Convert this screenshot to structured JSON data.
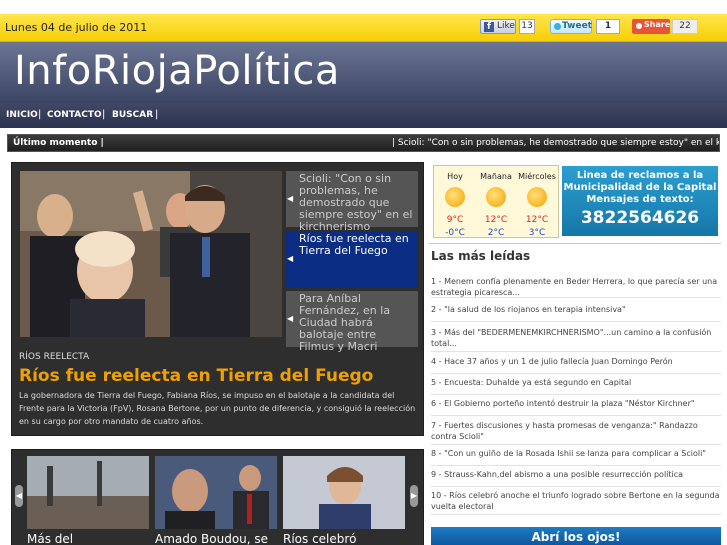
{
  "topbar": {
    "date": "Lunes 04 de julio de 2011",
    "like_label": "Like",
    "like_count": "13",
    "tweet_label": "Tweet",
    "tweet_count": "1",
    "share_label": "Share",
    "share_count": "22"
  },
  "header": {
    "site_title": "InfoRiojaPolítica"
  },
  "nav": {
    "items": [
      "INICIO",
      "CONTACTO",
      "BUSCAR"
    ],
    "separator": "|"
  },
  "ticker": {
    "label": "Último momento |",
    "news": "| Scioli: \"Con o sin problemas, he demostrado que siempre estoy\" en el kirchnerismo"
  },
  "feature": {
    "kicker": "Ríos reelecta",
    "headline": "Ríos fue reelecta en Tierra del Fuego",
    "summary": "La gobernadora de Tierra del Fuego, Fabiana Ríos, se impuso en el balotaje a la candidata del Frente para la Victoria (FpV), Rosana Bertone, por un punto de diferencia, y consiguió la reelección en su cargo por otro mandato de cuatro años.",
    "side_items": [
      "Scioli: \"Con o sin problemas, he demostrado que siempre estoy\" en el kirchnerismo",
      "Ríos fue reelecta en Tierra del Fuego",
      "Para Aníbal Fernández, en la Ciudad habrá balotaje entre Filmus y Macri"
    ]
  },
  "carousel": {
    "captions": [
      "Más del",
      "Amado Boudou, se",
      "Ríos celebró"
    ]
  },
  "weather": {
    "days": [
      {
        "day": "Hoy",
        "high": "9°C",
        "low": "-0°C"
      },
      {
        "day": "Mañana",
        "high": "12°C",
        "low": "2°C"
      },
      {
        "day": "Miércoles",
        "high": "12°C",
        "low": "3°C"
      }
    ],
    "colors": {
      "high": "#dd2222",
      "low": "#1a46c6"
    }
  },
  "claims_ad": {
    "line1": "Linea de reclamos a la",
    "line2": "Municipalidad de la Capital",
    "line3": "Mensajes de texto:",
    "phone": "3822564626"
  },
  "most_read": {
    "title": "Las más leídas",
    "items": [
      "1 - Menem confía plenamente en Beder Herrera, lo que parecía ser una estrategia picaresca...",
      "2 - \"la salud de los riojanos en terapia intensiva\"",
      "3 - Más del \"BEDERMENEMKIRCHNERISMO\"...un camino a la confusión total...",
      "4 - Hace 37 años y un 1 de julio fallecía Juan Domingo Perón",
      "5 - Encuesta: Duhalde ya está segundo en Capital",
      "6 - El Gobierno porteño intentó destruir la plaza \"Néstor Kirchner\"",
      "7 - Fuertes discusiones y hasta promesas de venganza:\" Randazzo contra Scioli\"",
      "8 - \"Con un guiño de la Rosada Ishii se lanza para complicar a Scioli\"",
      "9 - Strauss-Kahn,del abismo a una posible resurrección política",
      "10 - Ríos celebró anoche el triunfo logrado sobre Bertone en la segunda vuelta electoral"
    ]
  },
  "bottom_ad": {
    "text": "Abrí los ojos!"
  }
}
